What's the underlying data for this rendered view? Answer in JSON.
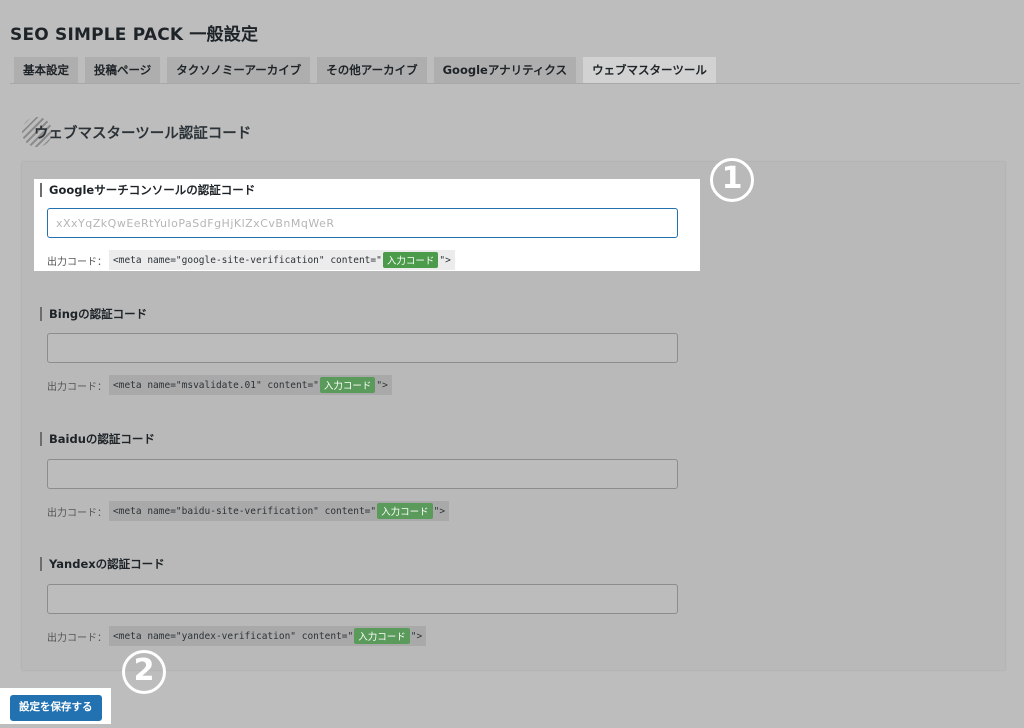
{
  "page_title": "SEO SIMPLE PACK 一般設定",
  "tabs": [
    {
      "label": "基本設定",
      "active": false
    },
    {
      "label": "投稿ページ",
      "active": false
    },
    {
      "label": "タクソノミーアーカイブ",
      "active": false
    },
    {
      "label": "その他アーカイブ",
      "active": false
    },
    {
      "label": "Googleアナリティクス",
      "active": false
    },
    {
      "label": "ウェブマスターツール",
      "active": true
    }
  ],
  "section_heading": "ウェブマスターツール認証コード",
  "output_label": "出力コード：",
  "fields": [
    {
      "label": "Googleサーチコンソールの認証コード",
      "value": "xXxYqZkQwEeRtYuIoPaSdFgHjKlZxCvBnMqWeR",
      "placeholder": "",
      "code_prefix": "<meta name=\"google-site-verification\" content=\"",
      "code_tag": "入力コード",
      "code_suffix": "\">"
    },
    {
      "label": "Bingの認証コード",
      "value": "",
      "placeholder": "",
      "code_prefix": "<meta name=\"msvalidate.01\" content=\"",
      "code_tag": "入力コード",
      "code_suffix": "\">"
    },
    {
      "label": "Baiduの認証コード",
      "value": "",
      "placeholder": "",
      "code_prefix": "<meta name=\"baidu-site-verification\" content=\"",
      "code_tag": "入力コード",
      "code_suffix": "\">"
    },
    {
      "label": "Yandexの認証コード",
      "value": "",
      "placeholder": "",
      "code_prefix": "<meta name=\"yandex-verification\" content=\"",
      "code_tag": "入力コード",
      "code_suffix": "\">"
    }
  ],
  "badges": {
    "one": "1",
    "two": "2"
  },
  "save_button_label": "設定を保存する",
  "colors": {
    "accent": "#2271b1",
    "code_tag": "#4b9b4b",
    "overlay": "#bdbdbd"
  }
}
